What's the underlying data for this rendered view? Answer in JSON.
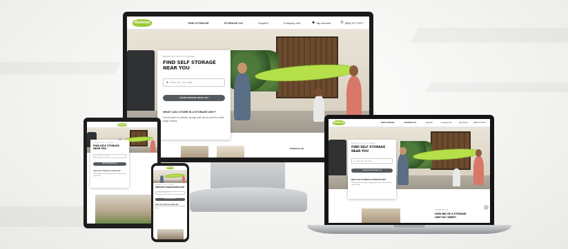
{
  "brand": {
    "logo_text": "Redwood",
    "accent": "#9ec93a",
    "button_color": "#555a5e"
  },
  "nav": {
    "items": [
      "FIND STORAGE",
      "STORAGE 101",
      "Español",
      "Company Info",
      "My Account",
      "(855) 977-3977"
    ]
  },
  "hero": {
    "eyebrow": "REDWOOD SELF STORAGE",
    "title": "FIND SELF STORAGE NEAR YOU",
    "title_short": "FIND SELF STORAGE NEAR YOU",
    "search_placeholder": "Enter Zip, City, State",
    "search_placeholder_short": "Enter Zip, City, State",
    "button": "SHOW STORAGE NEAR YOU",
    "button_short": "SEE STORAGE NEAR YOU",
    "question": "WHAT CAN I STORE IN A STORAGE UNIT?",
    "question_short": "WHAT CAN I STORE IN A STORAGE UNIT?",
    "answer": "From furniture to vehicles, storage units can be used for a wide range of items."
  },
  "laptop_section": {
    "eyebrow": "STORAGE 101",
    "heading": "HOW BIG OF A STORAGE UNIT DO I NEED?"
  },
  "monitor_section": {
    "heading": "STORAGE 101"
  },
  "icons": [
    "map-pin-icon",
    "user-icon",
    "phone-icon",
    "chevron-right-icon"
  ]
}
